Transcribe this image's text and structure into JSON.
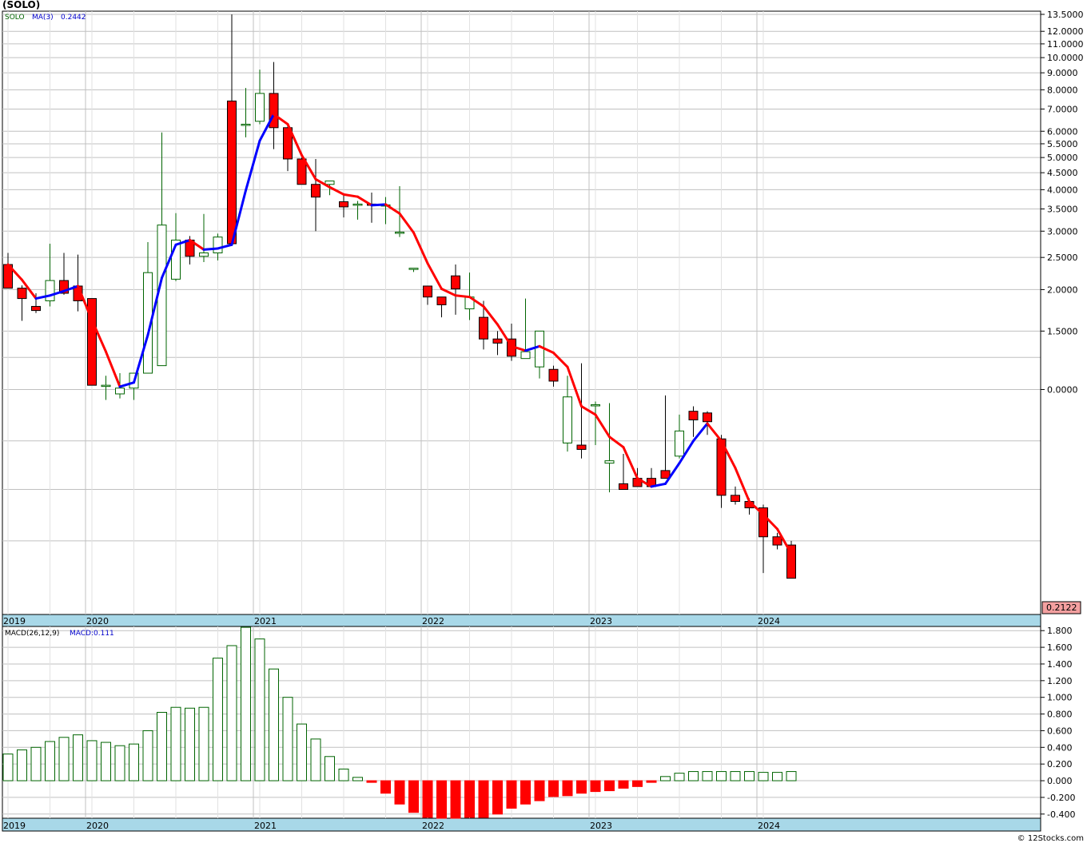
{
  "title": "(SOLO)",
  "footer": "© 12Stocks.com",
  "price_panel": {
    "label_symbol": "SOLO",
    "label_ma": "MA(3)",
    "label_ma_value": "0.2442",
    "last_price": "0.2122",
    "y_ticks": [
      "13.5000",
      "12.0000",
      "11.0000",
      "10.0000",
      "9.0000",
      "8.0000",
      "7.0000",
      "6.0000",
      "5.5000",
      "5.0000",
      "4.5000",
      "4.0000",
      "3.5000",
      "3.0000",
      "2.5000",
      "2.0000",
      "1.5000",
      "0.0000"
    ]
  },
  "macd_panel": {
    "label_params": "MACD(26,12,9)",
    "label_value": "MACD:0.111",
    "y_ticks": [
      "1.800",
      "1.600",
      "1.400",
      "1.200",
      "1.000",
      "0.800",
      "0.600",
      "0.400",
      "0.200",
      "0.000",
      "-0.200",
      "-0.400"
    ]
  },
  "x_axis_labels": [
    "2019",
    "2020",
    "2021",
    "2022",
    "2023",
    "2024"
  ],
  "colors": {
    "up": "#006400",
    "down": "#ff0000",
    "ma_up": "#0000ff",
    "ma_down": "#ff0000",
    "grid": "#c0c0c0",
    "axis_band": "#a8d8e8",
    "last_price_box": "#f4a0a0"
  },
  "chart_data": {
    "type": "candlestick",
    "interval": "monthly",
    "x_start": "2019-07",
    "x": [
      "2019-07",
      "2019-08",
      "2019-09",
      "2019-10",
      "2019-11",
      "2019-12",
      "2020-01",
      "2020-02",
      "2020-03",
      "2020-04",
      "2020-05",
      "2020-06",
      "2020-07",
      "2020-08",
      "2020-09",
      "2020-10",
      "2020-11",
      "2020-12",
      "2021-01",
      "2021-02",
      "2021-03",
      "2021-04",
      "2021-05",
      "2021-06",
      "2021-07",
      "2021-08",
      "2021-09",
      "2021-10",
      "2021-11",
      "2021-12",
      "2022-01",
      "2022-02",
      "2022-03",
      "2022-04",
      "2022-05",
      "2022-06",
      "2022-07",
      "2022-08",
      "2022-09",
      "2022-10",
      "2022-11",
      "2022-12",
      "2023-01",
      "2023-02",
      "2023-03",
      "2023-04",
      "2023-05",
      "2023-06",
      "2023-07",
      "2023-08",
      "2023-09",
      "2023-10",
      "2023-11",
      "2023-12",
      "2024-01",
      "2024-02",
      "2024-03"
    ],
    "open": [
      2.38,
      2.02,
      1.78,
      1.85,
      2.13,
      2.05,
      1.88,
      1.03,
      0.97,
      1.01,
      1.12,
      1.18,
      2.15,
      2.82,
      2.52,
      2.58,
      7.4,
      6.3,
      6.43,
      7.8,
      6.15,
      4.95,
      4.15,
      4.15,
      3.68,
      3.6,
      3.62,
      3.6,
      2.98,
      2.32,
      2.05,
      1.9,
      2.2,
      1.75,
      1.65,
      1.42,
      1.42,
      1.24,
      1.17,
      1.15,
      0.69,
      0.68,
      0.9,
      0.6,
      0.52,
      0.54,
      0.54,
      0.57,
      0.63,
      0.86,
      0.85,
      0.71,
      0.48,
      0.46,
      0.44,
      0.36,
      0.34
    ],
    "high": [
      2.58,
      2.06,
      1.95,
      2.75,
      2.58,
      2.55,
      1.88,
      1.1,
      1.12,
      1.11,
      2.78,
      5.95,
      3.4,
      2.9,
      3.38,
      2.95,
      13.5,
      8.1,
      9.2,
      9.7,
      6.25,
      5.0,
      4.95,
      4.15,
      3.9,
      3.7,
      3.92,
      3.8,
      4.1,
      2.32,
      2.05,
      1.9,
      2.38,
      2.25,
      1.85,
      1.5,
      1.58,
      1.88,
      1.5,
      1.18,
      1.1,
      1.2,
      0.92,
      0.91,
      0.64,
      0.58,
      0.58,
      0.96,
      0.84,
      0.89,
      0.86,
      0.73,
      0.51,
      0.47,
      0.45,
      0.37,
      0.35
    ],
    "low": [
      2.02,
      1.61,
      1.7,
      1.78,
      1.93,
      1.72,
      1.03,
      0.93,
      0.94,
      0.93,
      1.12,
      1.18,
      2.12,
      2.38,
      2.42,
      2.45,
      2.76,
      5.75,
      6.3,
      5.3,
      4.55,
      4.2,
      3.0,
      3.85,
      3.3,
      3.25,
      3.18,
      3.15,
      2.88,
      2.26,
      1.8,
      1.65,
      1.68,
      1.62,
      1.32,
      1.27,
      1.22,
      1.3,
      1.08,
      1.02,
      0.65,
      0.62,
      0.68,
      0.49,
      0.51,
      0.52,
      0.52,
      0.57,
      0.62,
      0.72,
      0.73,
      0.44,
      0.45,
      0.42,
      0.28,
      0.33,
      0.28
    ],
    "close": [
      2.02,
      1.88,
      1.73,
      2.13,
      1.95,
      1.85,
      1.03,
      1.03,
      1.01,
      1.12,
      2.25,
      3.13,
      2.82,
      2.52,
      2.58,
      2.88,
      2.75,
      6.3,
      7.8,
      6.15,
      4.95,
      4.15,
      3.8,
      4.25,
      3.55,
      3.62,
      3.6,
      3.6,
      2.98,
      2.32,
      1.9,
      1.8,
      2.01,
      1.9,
      1.42,
      1.38,
      1.26,
      1.3,
      1.5,
      1.06,
      0.95,
      0.66,
      0.9,
      0.61,
      0.5,
      0.51,
      0.51,
      0.54,
      0.75,
      0.81,
      0.8,
      0.48,
      0.46,
      0.44,
      0.36,
      0.34,
      0.27
    ],
    "ma3": [
      2.38,
      2.14,
      1.88,
      1.92,
      1.98,
      2.05,
      1.62,
      1.3,
      1.02,
      1.05,
      1.46,
      2.17,
      2.73,
      2.82,
      2.64,
      2.66,
      2.73,
      3.98,
      5.62,
      6.75,
      6.3,
      5.08,
      4.3,
      4.07,
      3.87,
      3.81,
      3.59,
      3.61,
      3.39,
      2.97,
      2.4,
      2.01,
      1.92,
      1.9,
      1.78,
      1.57,
      1.35,
      1.31,
      1.35,
      1.29,
      1.17,
      0.89,
      0.84,
      0.72,
      0.67,
      0.54,
      0.51,
      0.52,
      0.6,
      0.7,
      0.79,
      0.7,
      0.58,
      0.46,
      0.42,
      0.38,
      0.32
    ],
    "macd": [
      0.32,
      0.37,
      0.4,
      0.47,
      0.52,
      0.55,
      0.48,
      0.46,
      0.42,
      0.44,
      0.6,
      0.82,
      0.88,
      0.87,
      0.88,
      1.47,
      1.62,
      1.84,
      1.7,
      1.34,
      1.0,
      0.68,
      0.5,
      0.29,
      0.14,
      0.04,
      -0.02,
      -0.15,
      -0.28,
      -0.38,
      -0.44,
      -0.45,
      -0.45,
      -0.44,
      -0.44,
      -0.4,
      -0.33,
      -0.28,
      -0.24,
      -0.19,
      -0.18,
      -0.15,
      -0.13,
      -0.12,
      -0.09,
      -0.07,
      -0.02,
      0.05,
      0.09,
      0.11,
      0.11,
      0.11,
      0.11,
      0.11,
      0.1,
      0.1,
      0.11
    ],
    "ylim_price": [
      0.21,
      13.8
    ],
    "ylim_macd": [
      -0.45,
      1.85
    ],
    "y_scale": "log",
    "grid": true
  }
}
